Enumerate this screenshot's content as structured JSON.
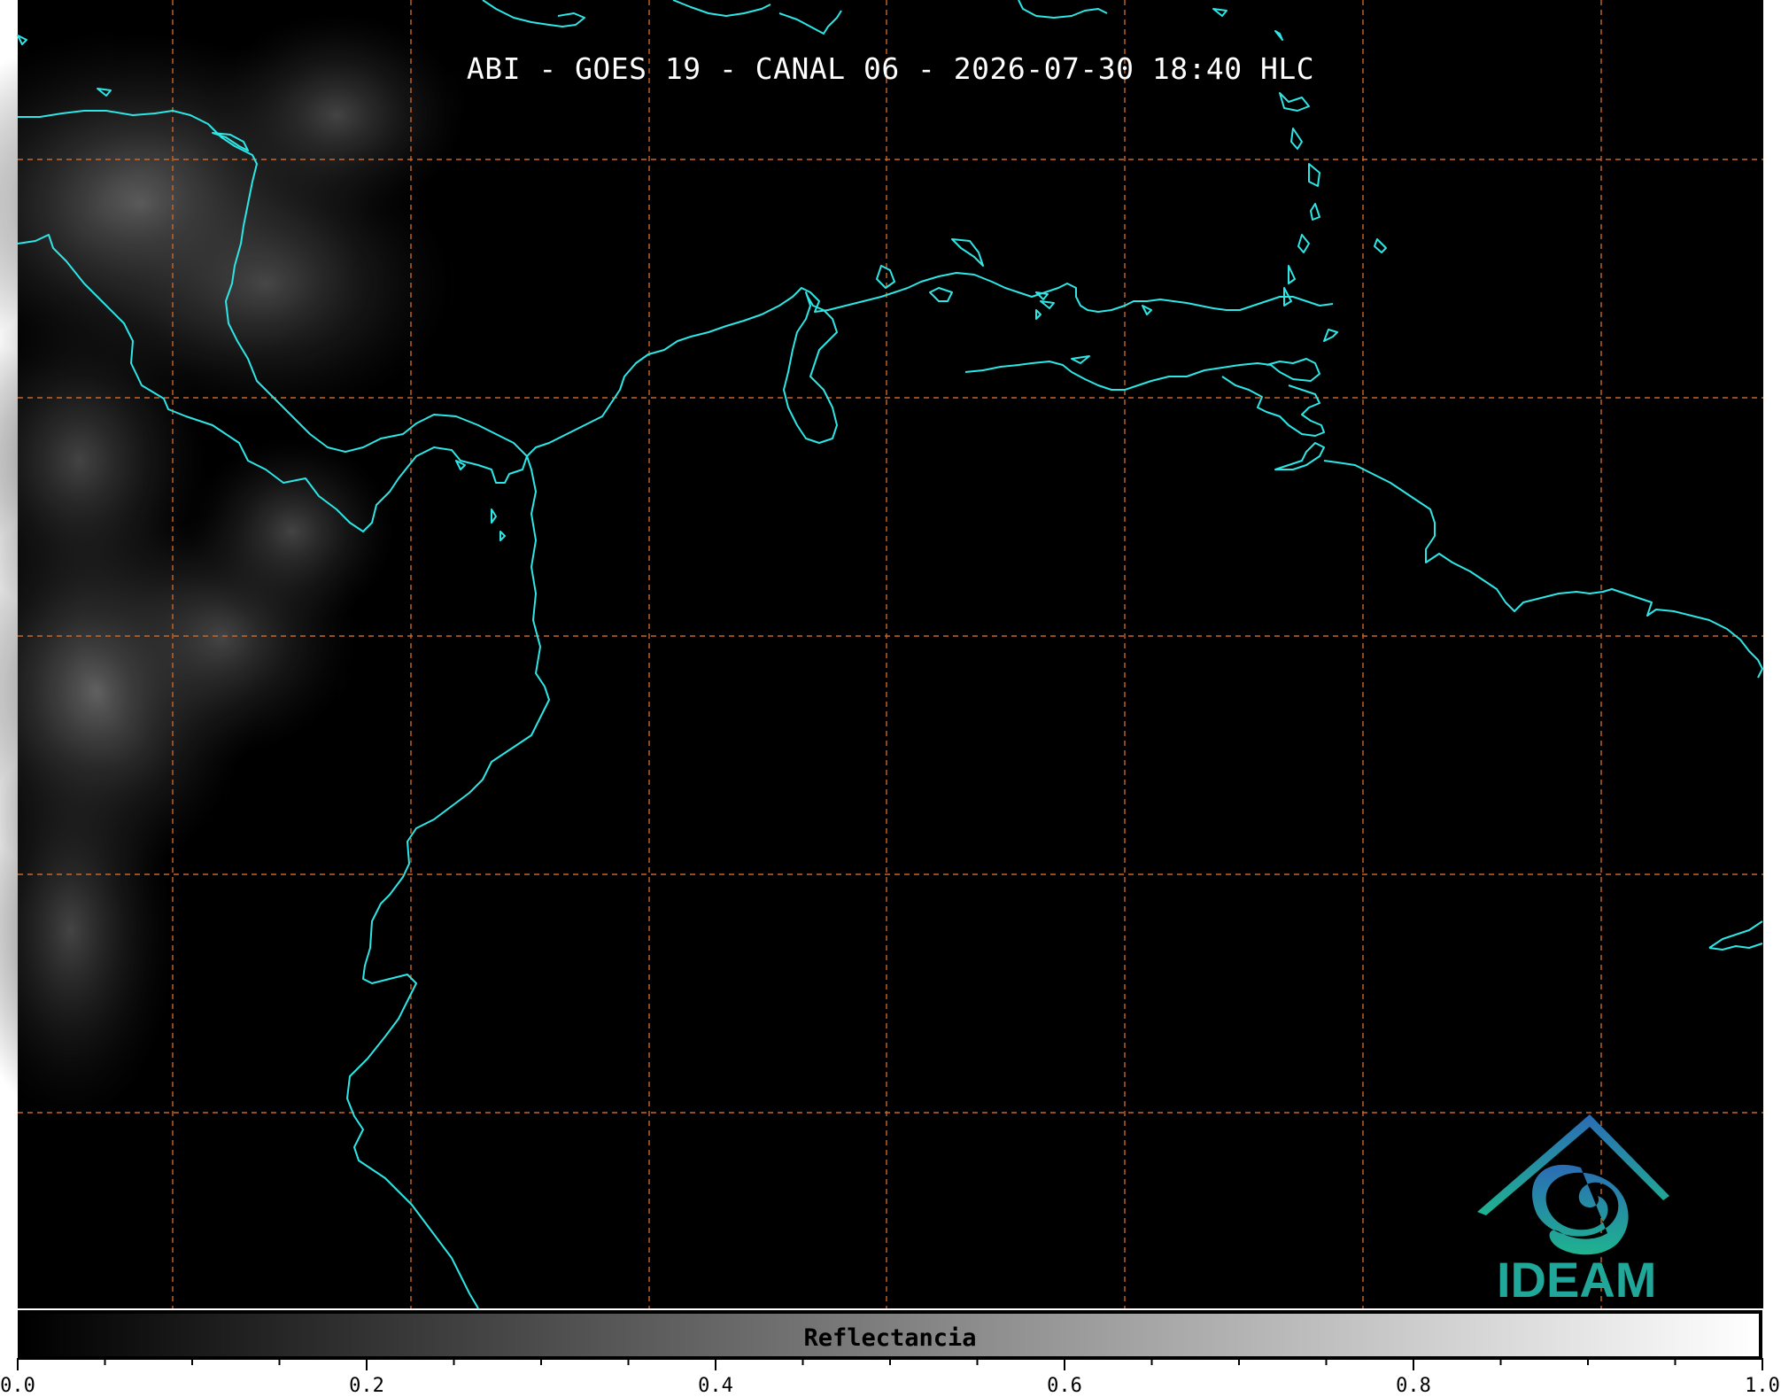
{
  "title": "ABI - GOES 19 - CANAL 06 - 2026-07-30 18:40 HLC",
  "logo": {
    "text": "IDEAM",
    "color": "#20a79a"
  },
  "colorbar": {
    "label": "Reflectancia",
    "min": 0.0,
    "max": 1.0,
    "tick_labels": [
      "0.0",
      "0.2",
      "0.4",
      "0.6",
      "0.8",
      "1.0"
    ],
    "minor_tick_count": 20,
    "colors": {
      "low": "#000000",
      "high": "#ffffff"
    }
  },
  "map": {
    "background_color": "#000000",
    "coastline_color": "#2ee6e6",
    "grid_color": "#c8662a",
    "grid_style": "dashed"
  }
}
